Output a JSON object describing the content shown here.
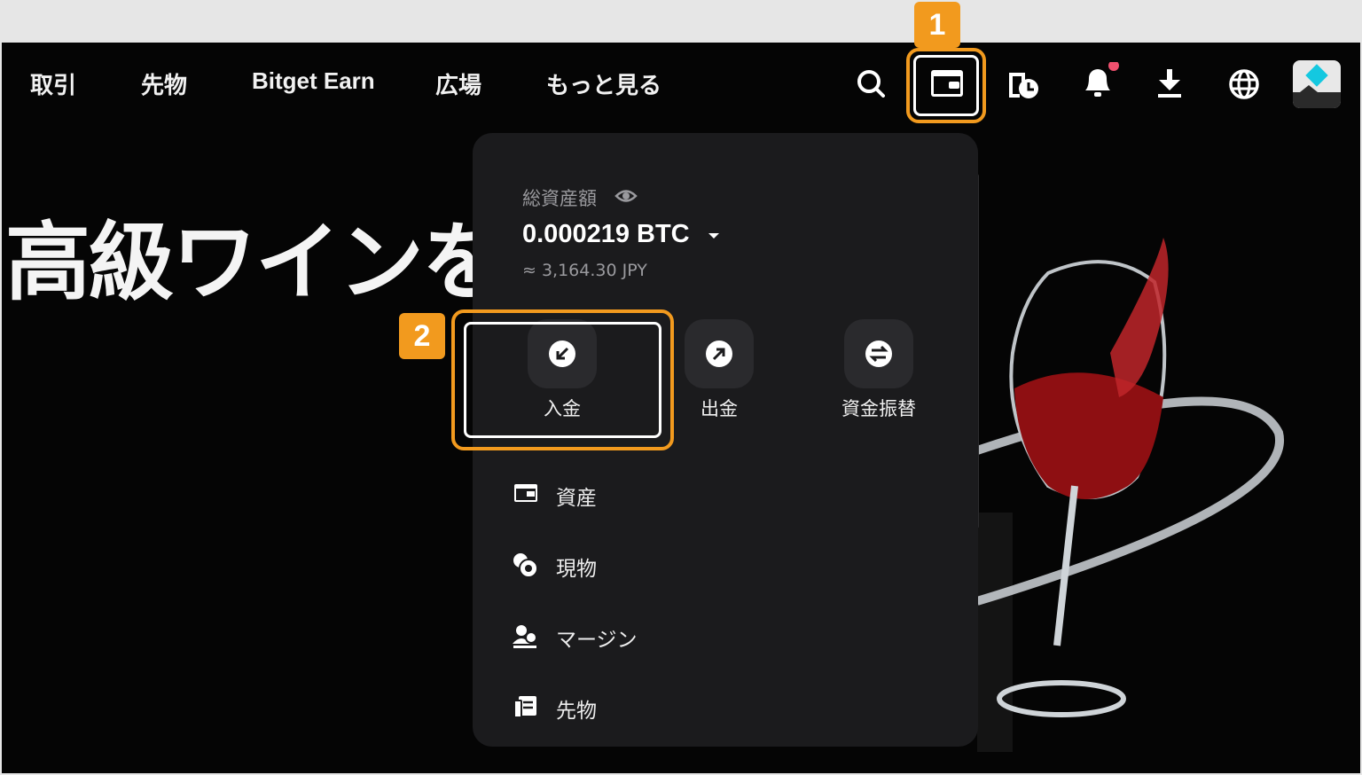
{
  "nav": {
    "items": [
      "取引",
      "先物",
      "Bitget Earn",
      "広場",
      "もっと見る"
    ]
  },
  "hero": {
    "text": "高級ワインを"
  },
  "wallet": {
    "total_label": "総資産額",
    "btc_amount": "0.000219 BTC",
    "jpy_amount": "≈ 3,164.30 JPY",
    "actions": [
      {
        "label": "入金",
        "icon": "arrow-down-left-icon"
      },
      {
        "label": "出金",
        "icon": "arrow-up-right-icon"
      },
      {
        "label": "資金振替",
        "icon": "swap-icon"
      }
    ],
    "menu": [
      {
        "label": "資産",
        "icon": "wallet-icon"
      },
      {
        "label": "現物",
        "icon": "coins-icon"
      },
      {
        "label": "マージン",
        "icon": "margin-icon"
      },
      {
        "label": "先物",
        "icon": "futures-icon"
      }
    ]
  },
  "annotations": {
    "step1": "1",
    "step2": "2"
  },
  "colors": {
    "accent": "#f29a1e",
    "panel": "#1b1b1d",
    "notification_dot": "#f0506e"
  }
}
